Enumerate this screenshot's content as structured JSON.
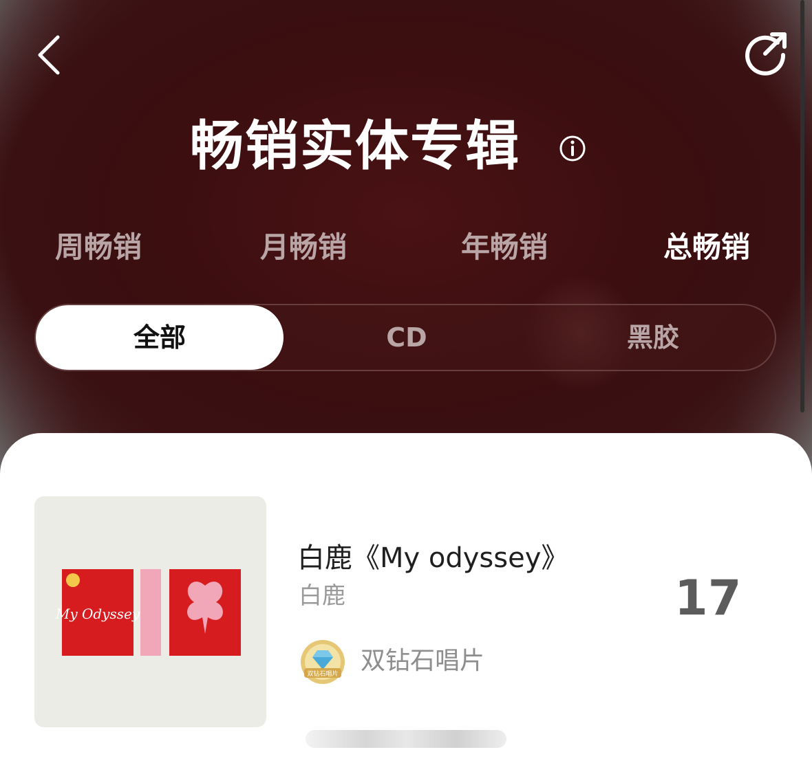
{
  "header": {
    "title": "畅销实体专辑",
    "back_icon": "chevron-left-icon",
    "share_icon": "share-icon",
    "info_icon": "info-icon"
  },
  "period_tabs": [
    {
      "label": "周畅销",
      "active": false
    },
    {
      "label": "月畅销",
      "active": false
    },
    {
      "label": "年畅销",
      "active": false
    },
    {
      "label": "总畅销",
      "active": true
    }
  ],
  "format_tabs": [
    {
      "label": "全部",
      "active": true
    },
    {
      "label": "CD",
      "active": false
    },
    {
      "label": "黑胶",
      "active": false
    }
  ],
  "list": [
    {
      "title": "白鹿《My odyssey》",
      "artist": "白鹿",
      "rank": "17",
      "badge_label": "双钻石唱片",
      "badge_icon_text": "双钻石唱片",
      "cover_text": "My Odyssey"
    }
  ],
  "colors": {
    "hero_bg": "#3c0f11",
    "active_tab": "#ffffff",
    "inactive_tab": "#b9a5a5",
    "cover_red": "#d71c20",
    "cover_pink": "#f2a7b8"
  }
}
